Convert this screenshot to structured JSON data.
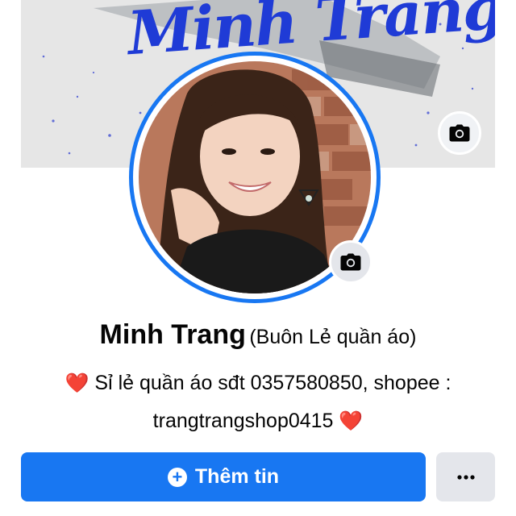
{
  "cover": {
    "title": "Minh Trang",
    "camera_icon": "camera-icon"
  },
  "avatar": {
    "camera_icon": "camera-icon"
  },
  "profile": {
    "name": "Minh Trang",
    "subtitle": "(Buôn Lẻ quần áo)",
    "bio_line1": "Sỉ lẻ quần áo sđt 0357580850, shopee :",
    "bio_line2": "trangtrangshop0415",
    "heart_emoji": "❤️"
  },
  "actions": {
    "add_story_label": "Thêm tin",
    "add_icon": "plus-circle-icon",
    "more_icon": "more-horizontal-icon"
  },
  "colors": {
    "accent": "#1877f2",
    "cover_text": "#1f3bd6",
    "heart": "#e0243a"
  }
}
